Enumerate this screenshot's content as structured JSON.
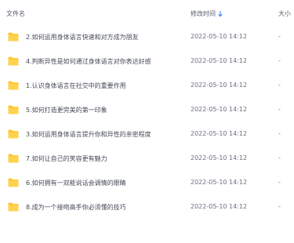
{
  "header": {
    "name_label": "文件名",
    "modified_label": "修改时间",
    "size_label": "大小",
    "sort_icon": "sort-descending-arrow-icon",
    "sort_color": "#3b82f6"
  },
  "folder_icon": {
    "name": "folder-icon",
    "color": "#ffc52e"
  },
  "rows": [
    {
      "name": "2.如何运用身体语言快速和对方成为朋友",
      "modified": "2022-05-10 14:12",
      "size": "-"
    },
    {
      "name": "4.判断异性是如何通过身体语言对你表达好感",
      "modified": "2022-05-10 14:12",
      "size": "-"
    },
    {
      "name": "1.认识身体语言在社交中的重要作用",
      "modified": "2022-05-10 14:12",
      "size": "-"
    },
    {
      "name": "5.如何打造更完美的第一印象",
      "modified": "2022-05-10 14:12",
      "size": "-"
    },
    {
      "name": "3.如何运用身体语言提升你和异性的亲密程度",
      "modified": "2022-05-10 14:12",
      "size": "-"
    },
    {
      "name": "7.如何让自己的笑容更有魅力",
      "modified": "2022-05-10 14:12",
      "size": "-"
    },
    {
      "name": "6.如何拥有一双能说话会调情的眼睛",
      "modified": "2022-05-10 14:12",
      "size": "-"
    },
    {
      "name": "8.成为一个接吻高手你必须懂的技巧",
      "modified": "2022-05-10 14:12",
      "size": "-"
    }
  ]
}
